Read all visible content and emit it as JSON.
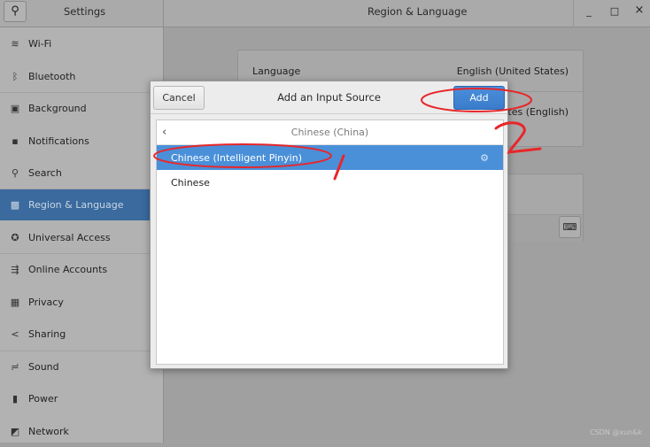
{
  "header": {
    "app_title": "Settings",
    "panel_title": "Region & Language",
    "search_icon": "search-icon",
    "minimize": "_",
    "maximize": "□",
    "close": "×"
  },
  "sidebar": {
    "items": [
      {
        "label": "Wi-Fi",
        "icon": "wifi-icon",
        "glyph": "≋"
      },
      {
        "label": "Bluetooth",
        "icon": "bluetooth-icon",
        "glyph": "ᛒ"
      },
      {
        "label": "Background",
        "icon": "background-icon",
        "glyph": "▣"
      },
      {
        "label": "Notifications",
        "icon": "notifications-icon",
        "glyph": "▪"
      },
      {
        "label": "Search",
        "icon": "search-icon",
        "glyph": "⚲"
      },
      {
        "label": "Region & Language",
        "icon": "region-icon",
        "glyph": "▩",
        "selected": true
      },
      {
        "label": "Universal Access",
        "icon": "accessibility-icon",
        "glyph": "✪"
      },
      {
        "label": "Online Accounts",
        "icon": "online-accounts-icon",
        "glyph": "⇶"
      },
      {
        "label": "Privacy",
        "icon": "privacy-icon",
        "glyph": "▦"
      },
      {
        "label": "Sharing",
        "icon": "share-icon",
        "glyph": "<"
      },
      {
        "label": "Sound",
        "icon": "sound-icon",
        "glyph": "≓"
      },
      {
        "label": "Power",
        "icon": "power-icon",
        "glyph": "▮"
      },
      {
        "label": "Network",
        "icon": "network-icon",
        "glyph": "◩"
      }
    ]
  },
  "main": {
    "language_label": "Language",
    "language_value": "English (United States)",
    "formats_value_visible": "tates (English)",
    "keyboard_icon": "keyboard-icon"
  },
  "dialog": {
    "title": "Add an Input Source",
    "cancel_label": "Cancel",
    "add_label": "Add",
    "list_header": "Chinese (China)",
    "back_glyph": "‹",
    "rows": [
      {
        "label": "Chinese (Intelligent Pinyin)",
        "selected": true,
        "has_settings": true
      },
      {
        "label": "Chinese",
        "selected": false
      }
    ]
  },
  "annotations": {
    "color": "#e8262a",
    "marks": [
      "1",
      "2"
    ]
  },
  "watermark": "CSDN @xun&k"
}
